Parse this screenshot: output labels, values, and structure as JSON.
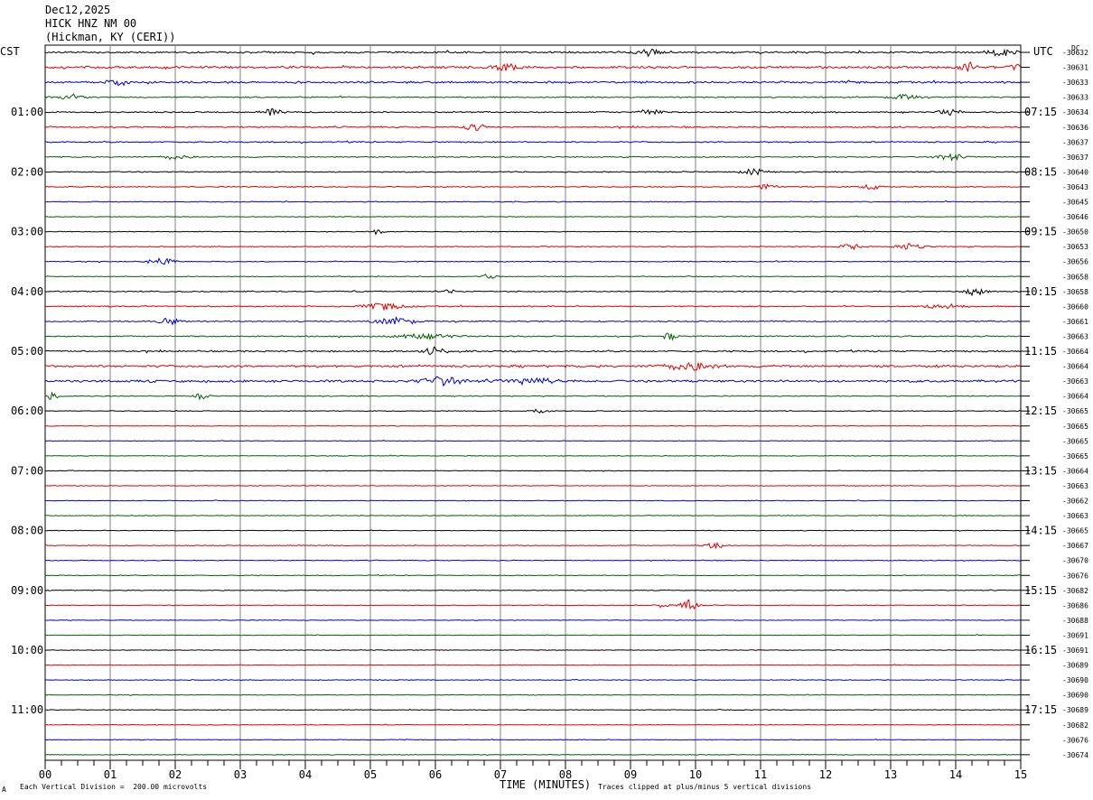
{
  "header": {
    "date": "Dec12,2025",
    "channel": "HICK HNZ NM 00",
    "location": "(Hickman, KY (CERI))"
  },
  "left_tz": "CST",
  "right_tz": "UTC",
  "dc_label": "DC",
  "footer": {
    "scale_note": "Each Vertical Division =  200.00 microvolts",
    "xlabel": "TIME (MINUTES)",
    "clip_note": "Traces clipped at plus/minus 5 vertical divisions",
    "corner_mark": "A"
  },
  "colors": {
    "trace_cycle": [
      "#000000",
      "#e00000",
      "#0000d0",
      "#006000"
    ],
    "grid": "#808080"
  },
  "chart_data": {
    "type": "line",
    "title": "",
    "xlabel": "TIME (MINUTES)",
    "xlim": [
      0,
      15
    ],
    "x_ticks": [
      "00",
      "01",
      "02",
      "03",
      "04",
      "05",
      "06",
      "07",
      "08",
      "09",
      "10",
      "11",
      "12",
      "13",
      "14",
      "15"
    ],
    "trace_count": 48,
    "trace_minutes": 15,
    "left_hour_labels": [
      "01:00",
      "02:00",
      "03:00",
      "04:00",
      "05:00",
      "06:00",
      "07:00",
      "08:00",
      "09:00",
      "10:00",
      "11:00"
    ],
    "left_label_trace_index": [
      4,
      8,
      12,
      16,
      20,
      24,
      28,
      32,
      36,
      40,
      44
    ],
    "right_hour_labels": [
      "07:15",
      "08:15",
      "09:15",
      "10:15",
      "11:15",
      "12:15",
      "13:15",
      "14:15",
      "15:15",
      "16:15",
      "17:15"
    ],
    "dc_offsets": [
      "-30632",
      "-30631",
      "-30633",
      "-30633",
      "-30634",
      "-30636",
      "-30637",
      "-30637",
      "-30640",
      "-30643",
      "-30645",
      "-30646",
      "-30650",
      "-30653",
      "-30656",
      "-30658",
      "-30658",
      "-30660",
      "-30661",
      "-30663",
      "-30664",
      "-30664",
      "-30663",
      "-30664",
      "-30665",
      "-30665",
      "-30665",
      "-30665",
      "-30664",
      "-30663",
      "-30662",
      "-30663",
      "-30665",
      "-30667",
      "-30670",
      "-30676",
      "-30682",
      "-30686",
      "-30688",
      "-30691",
      "-30691",
      "-30689",
      "-30690",
      "-30690",
      "-30689",
      "-30682",
      "-30676",
      "-30674"
    ],
    "noise_level": [
      0.8,
      1.0,
      0.9,
      0.6,
      0.6,
      0.7,
      0.6,
      0.5,
      0.5,
      0.5,
      0.4,
      0.35,
      0.35,
      0.4,
      0.4,
      0.35,
      0.5,
      0.55,
      0.55,
      0.55,
      0.7,
      1.0,
      1.0,
      0.45,
      0.35,
      0.3,
      0.3,
      0.3,
      0.3,
      0.3,
      0.3,
      0.3,
      0.3,
      0.35,
      0.35,
      0.35,
      0.35,
      0.35,
      0.3,
      0.3,
      0.3,
      0.3,
      0.3,
      0.3,
      0.3,
      0.3,
      0.3,
      0.3
    ],
    "bursts": [
      {
        "trace": 0,
        "minute": 9.3,
        "amp": 4.0,
        "width": 0.15
      },
      {
        "trace": 0,
        "minute": 14.7,
        "amp": 3.5,
        "width": 0.2
      },
      {
        "trace": 1,
        "minute": 7.1,
        "amp": 3.5,
        "width": 0.2
      },
      {
        "trace": 1,
        "minute": 14.2,
        "amp": 4.5,
        "width": 0.15
      },
      {
        "trace": 1,
        "minute": 14.9,
        "amp": 3.5,
        "width": 0.1
      },
      {
        "trace": 2,
        "minute": 1.1,
        "amp": 4.0,
        "width": 0.15
      },
      {
        "trace": 3,
        "minute": 0.4,
        "amp": 3.0,
        "width": 0.2
      },
      {
        "trace": 3,
        "minute": 13.2,
        "amp": 3.0,
        "width": 0.2
      },
      {
        "trace": 4,
        "minute": 3.5,
        "amp": 3.5,
        "width": 0.15
      },
      {
        "trace": 4,
        "minute": 9.3,
        "amp": 3.5,
        "width": 0.15
      },
      {
        "trace": 4,
        "minute": 13.9,
        "amp": 3.5,
        "width": 0.15
      },
      {
        "trace": 5,
        "minute": 6.6,
        "amp": 3.5,
        "width": 0.15
      },
      {
        "trace": 7,
        "minute": 13.9,
        "amp": 3.5,
        "width": 0.2
      },
      {
        "trace": 7,
        "minute": 2.0,
        "amp": 2.5,
        "width": 0.2
      },
      {
        "trace": 8,
        "minute": 10.9,
        "amp": 3.0,
        "width": 0.2
      },
      {
        "trace": 9,
        "minute": 11.1,
        "amp": 3.0,
        "width": 0.15
      },
      {
        "trace": 9,
        "minute": 12.7,
        "amp": 2.5,
        "width": 0.15
      },
      {
        "trace": 12,
        "minute": 5.1,
        "amp": 3.0,
        "width": 0.1
      },
      {
        "trace": 13,
        "minute": 13.3,
        "amp": 4.0,
        "width": 0.2
      },
      {
        "trace": 13,
        "minute": 12.4,
        "amp": 2.5,
        "width": 0.2
      },
      {
        "trace": 14,
        "minute": 1.8,
        "amp": 3.5,
        "width": 0.2
      },
      {
        "trace": 15,
        "minute": 6.8,
        "amp": 3.0,
        "width": 0.1
      },
      {
        "trace": 16,
        "minute": 14.3,
        "amp": 4.0,
        "width": 0.15
      },
      {
        "trace": 16,
        "minute": 6.2,
        "amp": 2.5,
        "width": 0.1
      },
      {
        "trace": 17,
        "minute": 5.2,
        "amp": 3.5,
        "width": 0.3
      },
      {
        "trace": 17,
        "minute": 13.8,
        "amp": 2.5,
        "width": 0.3
      },
      {
        "trace": 18,
        "minute": 1.9,
        "amp": 3.5,
        "width": 0.15
      },
      {
        "trace": 18,
        "minute": 5.4,
        "amp": 4.0,
        "width": 0.3
      },
      {
        "trace": 19,
        "minute": 9.6,
        "amp": 4.0,
        "width": 0.1
      },
      {
        "trace": 19,
        "minute": 5.8,
        "amp": 2.5,
        "width": 0.5
      },
      {
        "trace": 20,
        "minute": 6.0,
        "amp": 4.5,
        "width": 0.15
      },
      {
        "trace": 21,
        "minute": 9.9,
        "amp": 4.0,
        "width": 0.4
      },
      {
        "trace": 22,
        "minute": 6.1,
        "amp": 4.5,
        "width": 0.3
      },
      {
        "trace": 22,
        "minute": 7.5,
        "amp": 3.0,
        "width": 0.4
      },
      {
        "trace": 23,
        "minute": 0.1,
        "amp": 4.0,
        "width": 0.1
      },
      {
        "trace": 23,
        "minute": 2.4,
        "amp": 3.0,
        "width": 0.1
      },
      {
        "trace": 24,
        "minute": 7.6,
        "amp": 2.5,
        "width": 0.15
      },
      {
        "trace": 33,
        "minute": 10.3,
        "amp": 3.0,
        "width": 0.15
      },
      {
        "trace": 37,
        "minute": 9.9,
        "amp": 6.0,
        "width": 0.12
      },
      {
        "trace": 37,
        "minute": 9.5,
        "amp": 2.5,
        "width": 0.1
      }
    ]
  }
}
